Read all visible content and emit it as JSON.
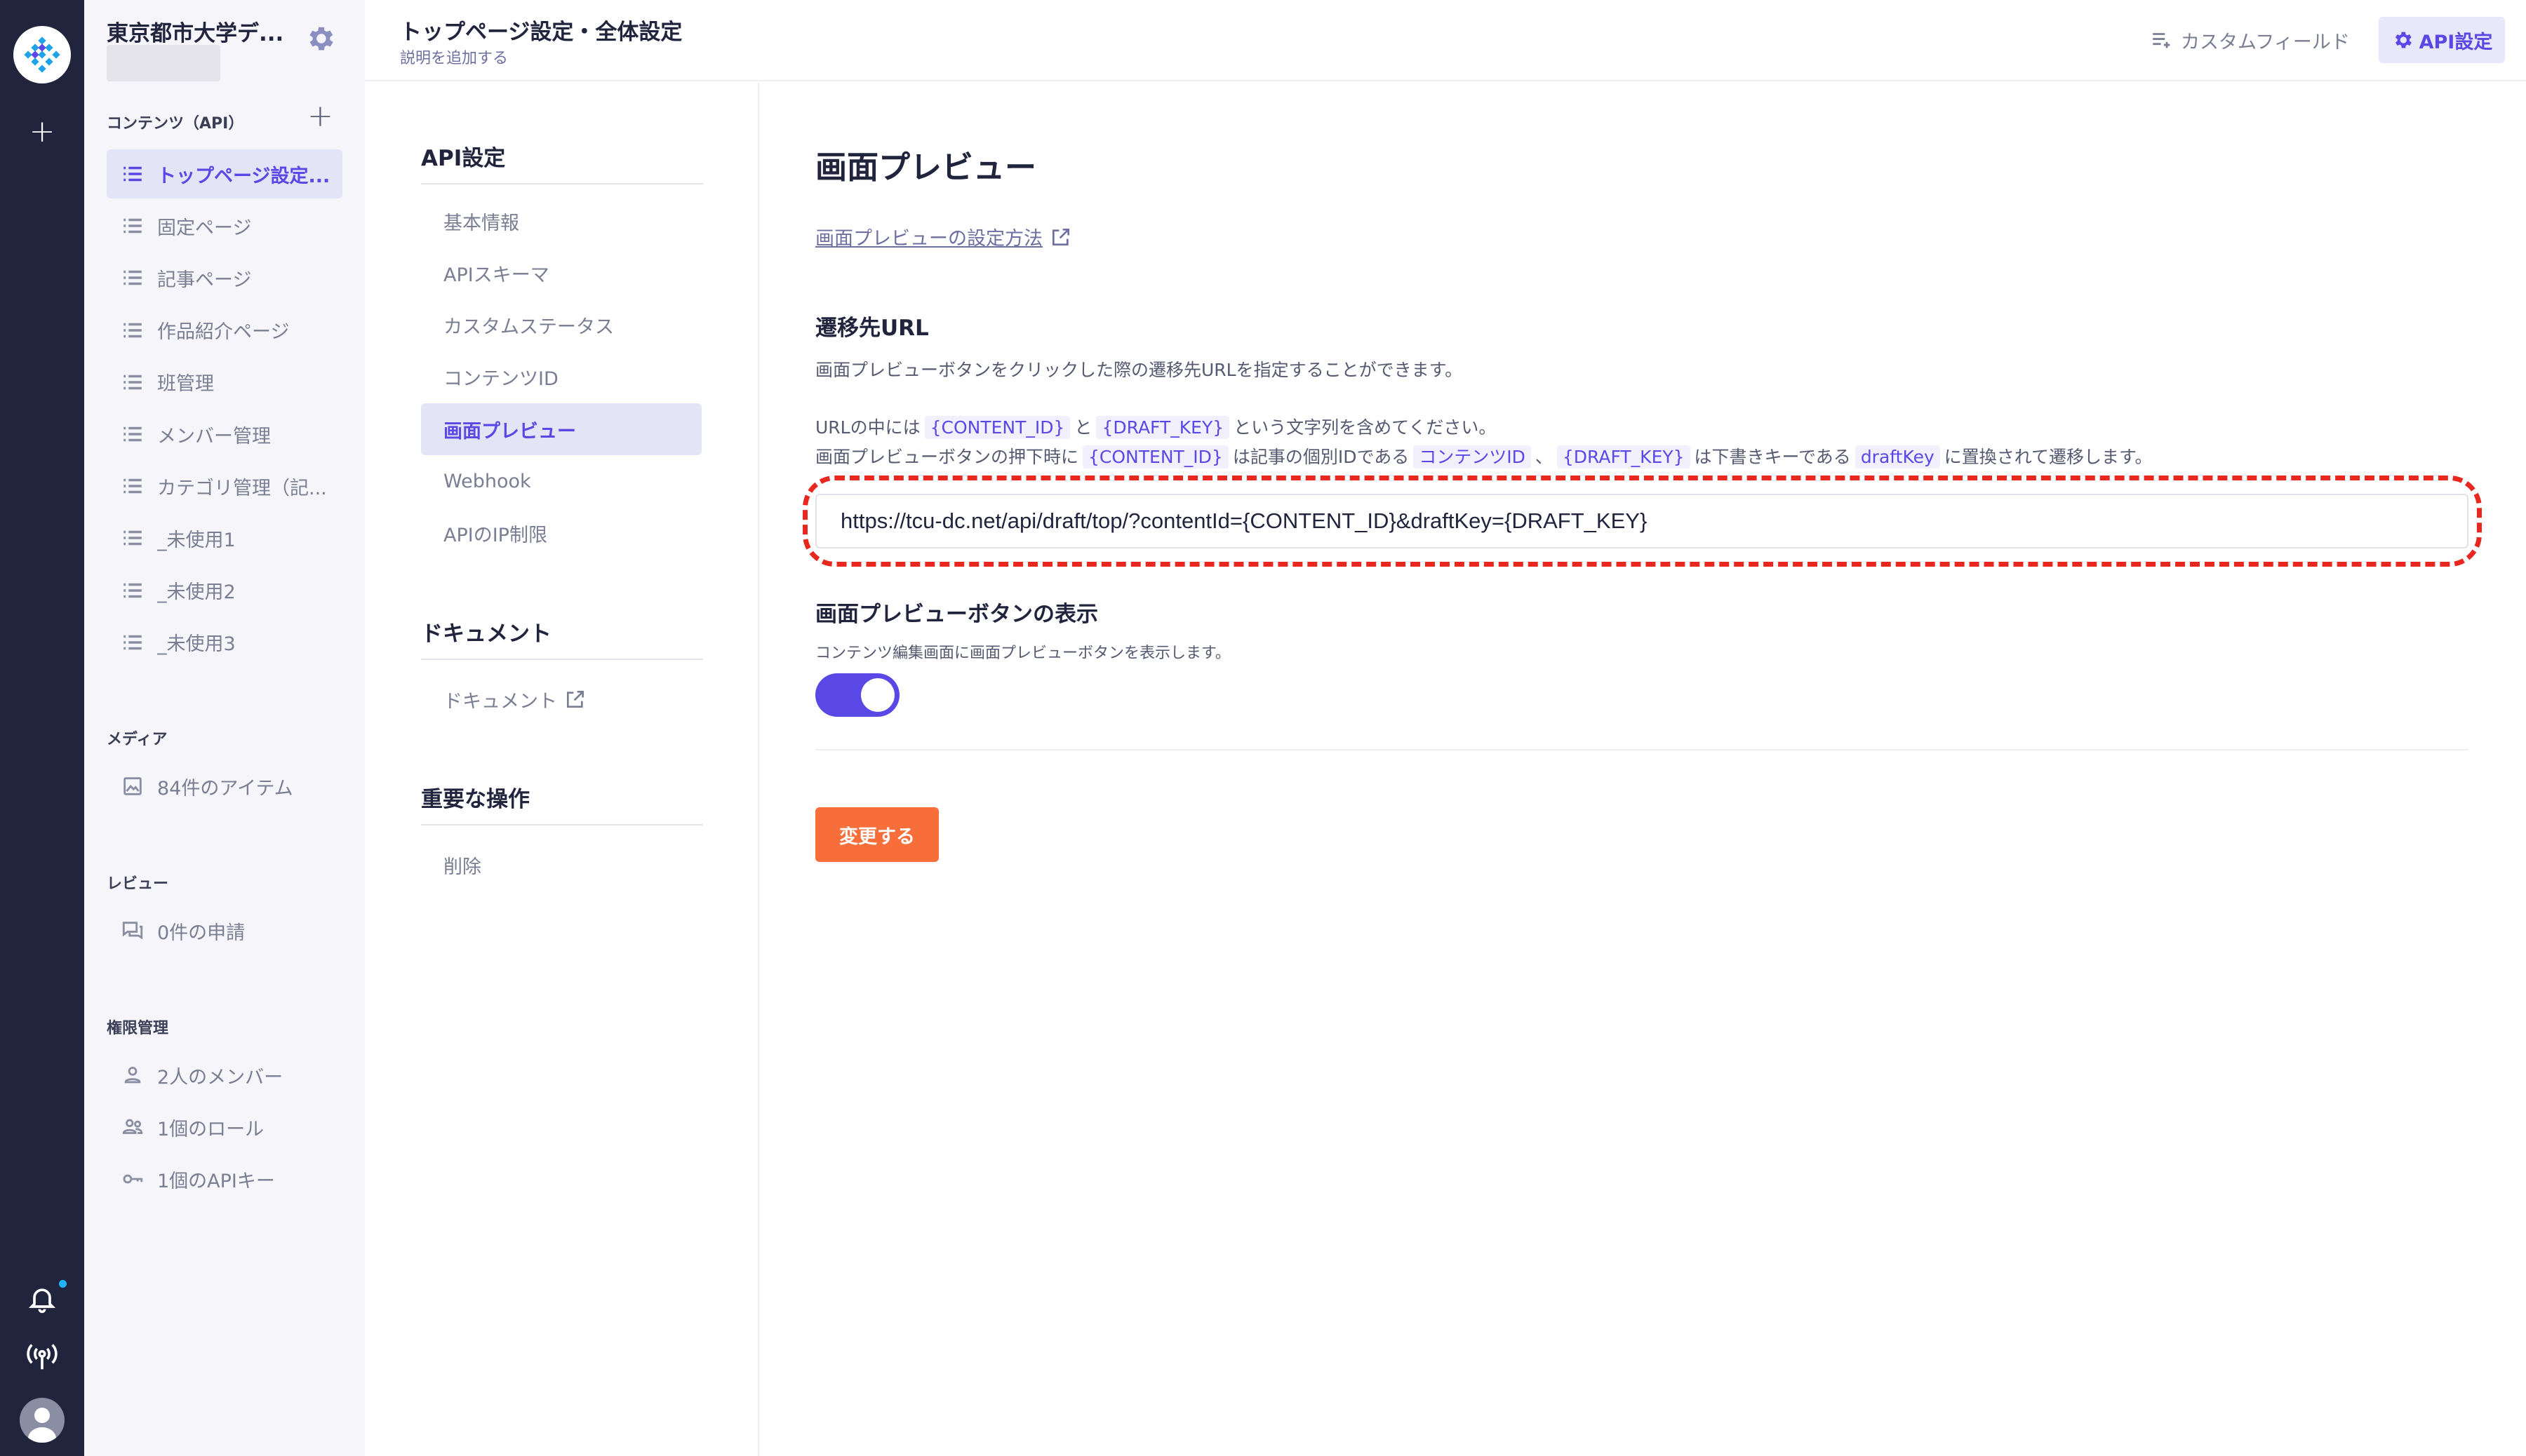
{
  "rail": {
    "icons": [
      "microcms-logo-icon",
      "plus-icon",
      "bell-icon",
      "broadcast-icon",
      "user-avatar-icon"
    ]
  },
  "sidebar": {
    "service_name": "東京都市大学デ...",
    "contents_label": "コンテンツ（API）",
    "items": [
      {
        "label": "トップページ設定...",
        "icon": "list-icon",
        "active": true
      },
      {
        "label": "固定ページ",
        "icon": "list-icon"
      },
      {
        "label": "記事ページ",
        "icon": "list-icon"
      },
      {
        "label": "作品紹介ページ",
        "icon": "list-icon"
      },
      {
        "label": "班管理",
        "icon": "list-icon"
      },
      {
        "label": "メンバー管理",
        "icon": "list-icon"
      },
      {
        "label": "カテゴリ管理（記...",
        "icon": "list-icon"
      },
      {
        "label": "_未使用1",
        "icon": "list-icon"
      },
      {
        "label": "_未使用2",
        "icon": "list-icon"
      },
      {
        "label": "_未使用3",
        "icon": "list-icon"
      }
    ],
    "media_label": "メディア",
    "media_item": "84件のアイテム",
    "review_label": "レビュー",
    "review_item": "0件の申請",
    "permission_label": "権限管理",
    "permission_items": [
      "2人のメンバー",
      "1個のロール",
      "1個のAPIキー"
    ]
  },
  "header": {
    "title": "トップページ設定・全体設定",
    "subtitle": "説明を追加する",
    "custom_field": "カスタムフィールド",
    "api_settings": "API設定"
  },
  "submenu": {
    "api_heading": "API設定",
    "api_items": [
      "基本情報",
      "APIスキーマ",
      "カスタムステータス",
      "コンテンツID",
      "画面プレビュー",
      "Webhook",
      "APIのIP制限"
    ],
    "active_item": "画面プレビュー",
    "doc_heading": "ドキュメント",
    "doc_item": "ドキュメント",
    "danger_heading": "重要な操作",
    "danger_item": "削除"
  },
  "main": {
    "title": "画面プレビュー",
    "help_link": "画面プレビューの設定方法",
    "url_heading": "遷移先URL",
    "url_desc": "画面プレビューボタンをクリックした際の遷移先URLを指定することができます。",
    "line1": {
      "a": "URLの中には",
      "code1": "{CONTENT_ID}",
      "b": "と",
      "code2": "{DRAFT_KEY}",
      "c": "という文字列を含めてください。"
    },
    "line2": {
      "a": "画面プレビューボタンの押下時に",
      "code1": "{CONTENT_ID}",
      "b": "は記事の個別IDである",
      "code2": "コンテンツID",
      "c": "、",
      "code3": "{DRAFT_KEY}",
      "d": "は下書きキーである",
      "code4": "draftKey",
      "e": "に置換されて遷移します。"
    },
    "url_value": "https://tcu-dc.net/api/draft/top/?contentId={CONTENT_ID}&draftKey={DRAFT_KEY}",
    "highlight_color": "#e8281e",
    "button_heading": "画面プレビューボタンの表示",
    "button_desc": "コンテンツ編集画面に画面プレビューボタンを表示します。",
    "toggle_on": true,
    "submit_label": "変更する",
    "accent_color": "#5a48e6",
    "submit_color": "#f76e3b"
  }
}
